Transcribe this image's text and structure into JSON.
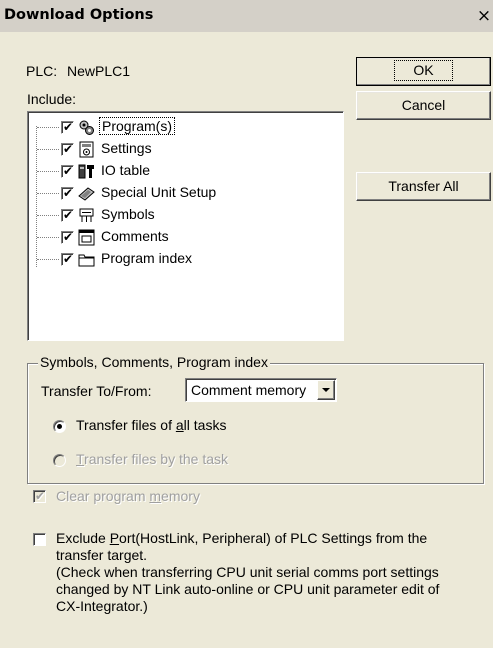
{
  "window": {
    "title": "Download Options",
    "close_glyph": "×"
  },
  "plc": {
    "label": "PLC:",
    "name": "NewPLC1"
  },
  "include_label": "Include:",
  "buttons": {
    "ok": "OK",
    "cancel": "Cancel",
    "transfer_all": "Transfer All"
  },
  "tree": {
    "items": [
      {
        "label": "Program(s)",
        "checked": true,
        "icon": "program-icon"
      },
      {
        "label": "Settings",
        "checked": true,
        "icon": "settings-icon"
      },
      {
        "label": "IO table",
        "checked": true,
        "icon": "io-table-icon"
      },
      {
        "label": "Special Unit Setup",
        "checked": true,
        "icon": "special-unit-icon"
      },
      {
        "label": "Symbols",
        "checked": true,
        "icon": "symbols-icon"
      },
      {
        "label": "Comments",
        "checked": true,
        "icon": "comments-icon"
      },
      {
        "label": "Program index",
        "checked": true,
        "icon": "folder-icon"
      }
    ]
  },
  "group": {
    "title": "Symbols, Comments, Program index",
    "transfer_label": "Transfer To/From:",
    "combo_value": "Comment memory",
    "radio_all_pre": "Transfer files of ",
    "radio_all_u": "a",
    "radio_all_post": "ll tasks",
    "radio_task_u": "T",
    "radio_task_post": "ransfer files by the task"
  },
  "clear": {
    "pre": "Clear program ",
    "u": "m",
    "post": "emory",
    "checked": true
  },
  "exclude": {
    "line1_pre": "Exclude ",
    "line1_u": "P",
    "line1_post": "ort(HostLink, Peripheral) of PLC Settings from the",
    "line2": "transfer target.",
    "line3": "(Check when transferring CPU unit serial comms port settings",
    "line4": "changed by NT Link auto-online or CPU unit parameter edit of",
    "line5": "CX-Integrator.)",
    "checked": false
  },
  "glyphs": {
    "check": "✔"
  }
}
